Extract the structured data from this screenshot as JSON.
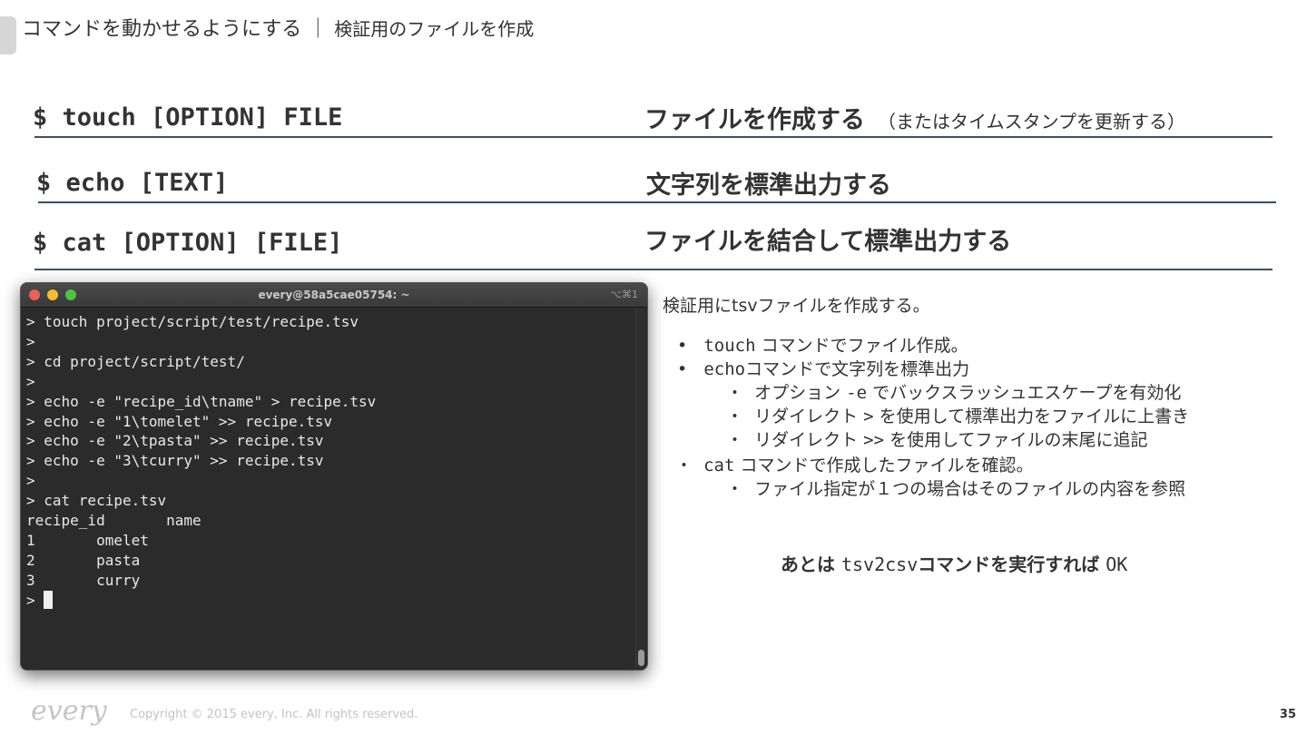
{
  "header": {
    "title": "コマンドを動かせるようにする",
    "separator": "｜",
    "subtitle": "検証用のファイルを作成"
  },
  "commands": [
    {
      "syntax": "$ touch [OPTION] FILE",
      "description": "ファイルを作成する",
      "note": "（またはタイムスタンプを更新する）"
    },
    {
      "syntax": "$ echo [TEXT]",
      "description": "文字列を標準出力する",
      "note": ""
    },
    {
      "syntax": "$ cat [OPTION] [FILE]",
      "description": "ファイルを結合して標準出力する",
      "note": ""
    }
  ],
  "terminal": {
    "title": "every@58a5cae05754: ~",
    "shortcut": "⌥⌘1",
    "lines": [
      "> touch project/script/test/recipe.tsv",
      ">",
      "> cd project/script/test/",
      ">",
      "> echo -e \"recipe_id\\tname\" > recipe.tsv",
      "> echo -e \"1\\tomelet\" >> recipe.tsv",
      "> echo -e \"2\\tpasta\" >> recipe.tsv",
      "> echo -e \"3\\tcurry\" >> recipe.tsv",
      ">",
      "> cat recipe.tsv",
      "recipe_id       name",
      "1       omelet",
      "2       pasta",
      "3       curry"
    ],
    "prompt": "> "
  },
  "notes": {
    "lead": "検証用にtsvファイルを作成する。",
    "items": [
      {
        "bullet": "•",
        "code": "touch",
        "text": " コマンドでファイル作成。"
      },
      {
        "bullet": "•",
        "code": "echo",
        "text": "コマンドで文字列を標準出力"
      },
      {
        "bullet": "・",
        "text": "オプション ",
        "code": "-e",
        "text2": " でバックスラッシュエスケープを有効化"
      },
      {
        "bullet": "・",
        "text": "リダイレクト ",
        "code": ">",
        "text2": " を使用して標準出力をファイルに上書き"
      },
      {
        "bullet": "・",
        "text": "リダイレクト ",
        "code": ">>",
        "text2": " を使用してファイルの末尾に追記"
      },
      {
        "bullet": "・",
        "code": "cat",
        "text": " コマンドで作成したファイルを確認。"
      },
      {
        "bullet": "・",
        "text": "ファイル指定が１つの場合はそのファイルの内容を参照"
      }
    ]
  },
  "conclusion": {
    "prefix": "あとは ",
    "code": "tsv2csv",
    "middle": "コマンドを実行すれば ",
    "ok": "OK"
  },
  "footer": {
    "logo": "every",
    "copyright": "Copyright © 2015 every, Inc. All rights reserved.",
    "page": "35"
  }
}
